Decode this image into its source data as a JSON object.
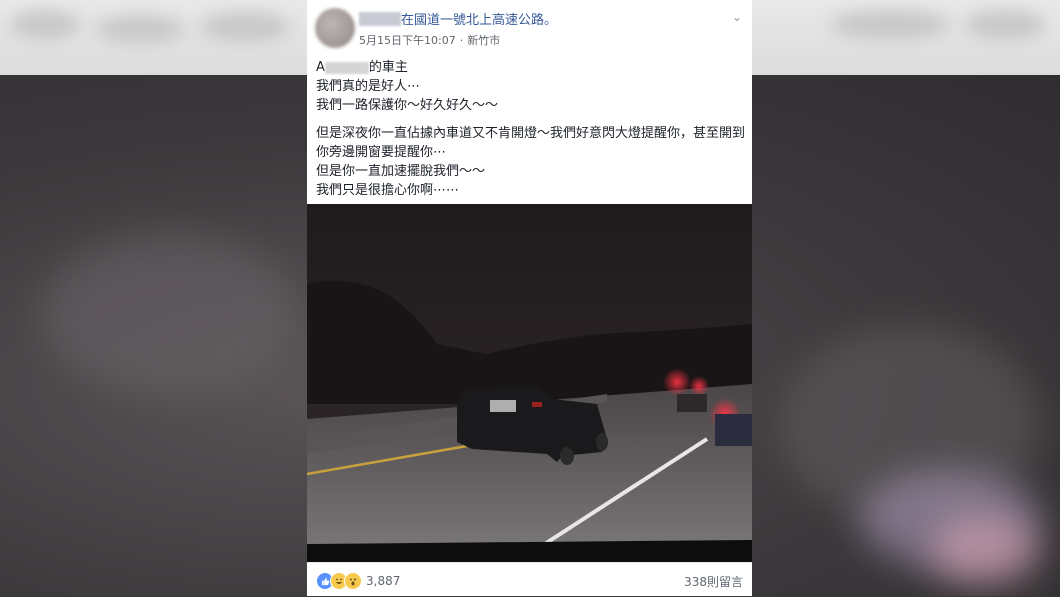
{
  "post": {
    "location": "在國道一號北上高速公路。",
    "date": "5月15日下午10:07",
    "separator": "·",
    "city": "新竹市",
    "chevron": "⌄",
    "body": {
      "owner_prefix": "A",
      "owner_suffix": "的車主",
      "line1": "我們真的是好人⋯",
      "line2": "我們一路保護你～好久好久～～",
      "line3": "但是深夜你一直佔據內車道又不肯開燈～我們好意閃大燈提醒你，甚至開到你旁邊開窗要提醒你⋯",
      "line4": "但是你一直加速擺脫我們～～",
      "line5": "我們只是很擔心你啊⋯⋯"
    },
    "reactions": {
      "icons": [
        "like-icon",
        "haha-icon",
        "wow-icon"
      ],
      "count": "3,887"
    },
    "comments": "338則留言"
  },
  "colors": {
    "link": "#365899",
    "meta": "#616770",
    "text": "#1d2129",
    "like": "#5890ff",
    "emoji": "#f7c94c"
  }
}
